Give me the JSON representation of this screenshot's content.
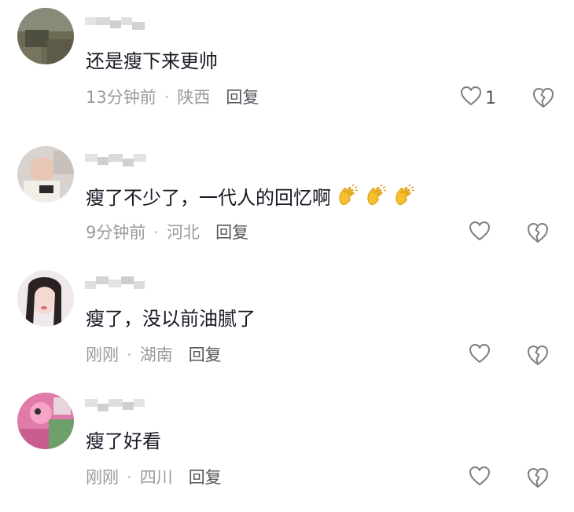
{
  "comments": [
    {
      "text": "还是瘦下来更帅",
      "time": "13分钟前",
      "separator": "·",
      "location": "陕西",
      "reply_label": "回复",
      "like_count": "1",
      "icons": {
        "like": "heart-outline-icon",
        "dislike": "broken-heart-icon"
      }
    },
    {
      "text": "瘦了不少了，一代人的回忆啊",
      "emojis": [
        "👏",
        "👏",
        "👏"
      ],
      "time": "9分钟前",
      "separator": "·",
      "location": "河北",
      "reply_label": "回复",
      "like_count": "",
      "icons": {
        "like": "heart-outline-icon",
        "dislike": "broken-heart-icon"
      }
    },
    {
      "text": "瘦了，没以前油腻了",
      "time": "刚刚",
      "separator": "·",
      "location": "湖南",
      "reply_label": "回复",
      "like_count": "",
      "icons": {
        "like": "heart-outline-icon",
        "dislike": "broken-heart-icon"
      }
    },
    {
      "text": "瘦了好看",
      "time": "刚刚",
      "separator": "·",
      "location": "四川",
      "reply_label": "回复",
      "like_count": "",
      "icons": {
        "like": "heart-outline-icon",
        "dislike": "broken-heart-icon"
      }
    }
  ],
  "colors": {
    "text": "#161823",
    "meta": "#9a9aa0",
    "icon": "#7d7d82"
  }
}
